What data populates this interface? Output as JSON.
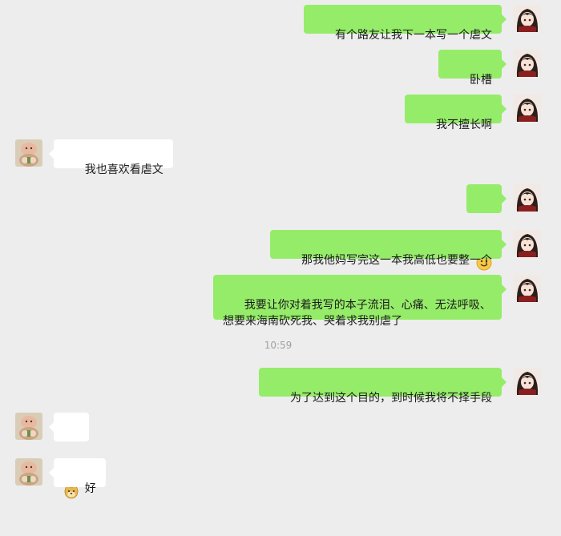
{
  "timestamp": "10:59",
  "messages": [
    {
      "side": "me",
      "text": "有个路友让我下一本写一个虐文"
    },
    {
      "side": "me",
      "text": "卧槽"
    },
    {
      "side": "me",
      "text": "我不擅长啊"
    },
    {
      "side": "other",
      "text": "我也喜欢看虐文"
    },
    {
      "side": "me",
      "emoji": "smile-emoji"
    },
    {
      "side": "me",
      "text": "那我他妈写完这一本我高低也要整一个"
    },
    {
      "side": "me",
      "text": "我要让你对着我写的本子流泪、心痛、无法呼吸、想要来海南砍死我、哭着求我别虐了"
    },
    {
      "side": "me",
      "text": "为了达到这个目的，到时候我将不择手段"
    },
    {
      "side": "other",
      "emoji": "doge-emoji"
    },
    {
      "side": "other",
      "text": "好"
    }
  ],
  "colors": {
    "me_bubble": "#95ec69",
    "other_bubble": "#ffffff",
    "background": "#ededed"
  }
}
